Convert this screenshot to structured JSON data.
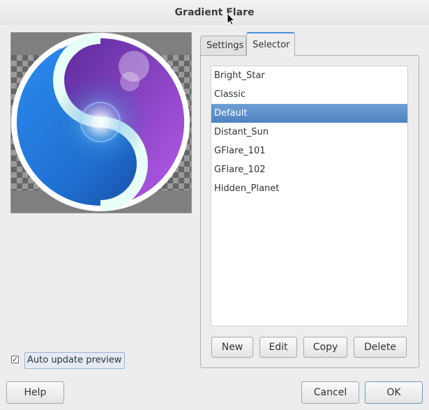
{
  "window": {
    "title": "Gradient Flare"
  },
  "tabs": [
    {
      "label": "Settings",
      "active": false
    },
    {
      "label": "Selector",
      "active": true
    }
  ],
  "flare_list": {
    "items": [
      "Bright_Star",
      "Classic",
      "Default",
      "Distant_Sun",
      "GFlare_101",
      "GFlare_102",
      "Hidden_Planet"
    ],
    "selected": "Default"
  },
  "list_buttons": {
    "new": "New",
    "edit": "Edit",
    "copy": "Copy",
    "delete": "Delete"
  },
  "preview_options": {
    "auto_update_label": "Auto update preview",
    "auto_update_checked": true
  },
  "dialog_buttons": {
    "help": "Help",
    "cancel": "Cancel",
    "ok": "OK"
  },
  "colors": {
    "selection": "#5b8dcb",
    "accent": "#4a90d9",
    "window_bg": "#ededed"
  }
}
